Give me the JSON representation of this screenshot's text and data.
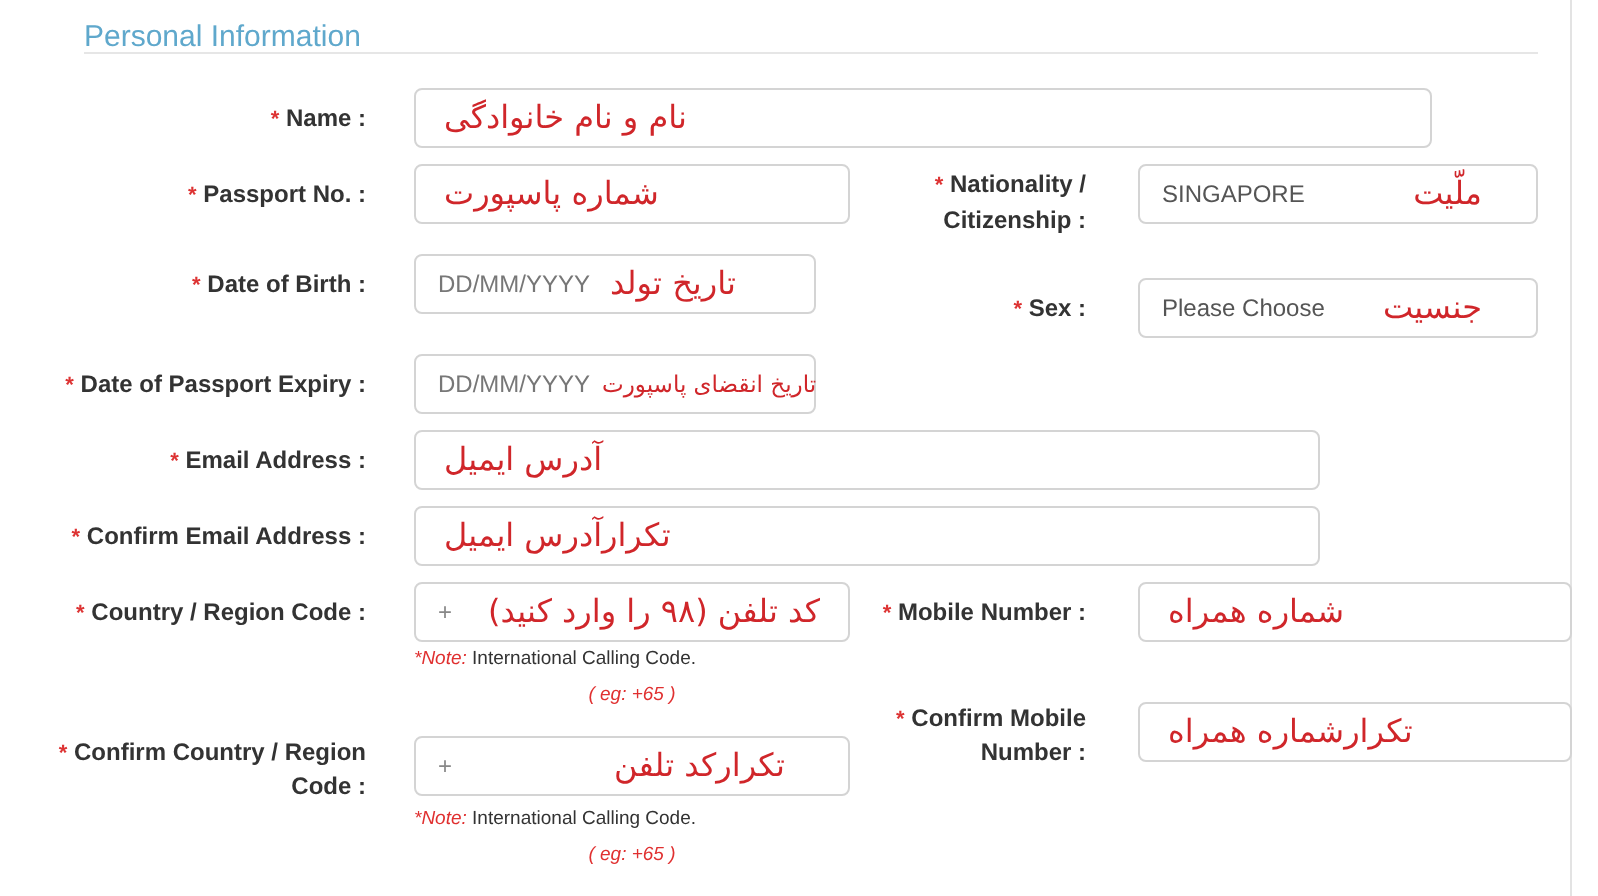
{
  "section": {
    "title": "Personal Information"
  },
  "rows": [
    {
      "field": {
        "marker": "*",
        "label": "Name :",
        "kind": "text",
        "annotation": "نام و نام خانوادگی"
      }
    },
    {
      "field": {
        "marker": "*",
        "label": "Passport No. :",
        "kind": "text",
        "annotation": "شماره پاسپورت"
      },
      "paired_field": {
        "marker": "*",
        "label": "Nationality / Citizenship :",
        "kind": "select",
        "value": "SINGAPORE",
        "annotation": "ملّیت"
      }
    },
    {
      "field": {
        "marker": "*",
        "label": "Date of Birth :",
        "kind": "date",
        "placeholder": "DD/MM/YYYY",
        "annotation": "تاریخ تولد"
      },
      "paired_field": {
        "marker": "*",
        "label": "Sex :",
        "kind": "select",
        "value": "Please Choose",
        "annotation": "جنسیت"
      }
    },
    {
      "field": {
        "marker": "*",
        "label": "Date of Passport Expiry :",
        "kind": "date",
        "placeholder": "DD/MM/YYYY",
        "annotation": "تاریخ انقضای پاسپورت"
      }
    },
    {
      "field": {
        "marker": "*",
        "label": "Email Address :",
        "kind": "text",
        "annotation": "آدرس ایمیل"
      }
    },
    {
      "field": {
        "marker": "*",
        "label": "Confirm Email Address :",
        "kind": "text",
        "annotation": "تکرارآدرس ایمیل"
      }
    },
    {
      "field": {
        "marker": "*",
        "label": "Country / Region Code :",
        "kind": "phone",
        "prefix": "+",
        "annotation": "کد تلفن (۹۸ را وارد کنید)"
      },
      "paired_field": {
        "marker": "*",
        "label": "Mobile Number :",
        "kind": "text",
        "annotation": "شماره همراه"
      },
      "note": {
        "label": "*Note:",
        "text": "International Calling Code.",
        "example": "( eg: +65 )"
      }
    },
    {
      "field": {
        "marker": "*",
        "label": "Confirm Country / Region Code :",
        "kind": "phone",
        "prefix": "+",
        "annotation": "تکرارکد تلفن"
      },
      "paired_field": {
        "marker": "*",
        "label": "Confirm Mobile Number :",
        "kind": "text",
        "annotation": "تکرارشماره همراه"
      },
      "note": {
        "label": "*Note:",
        "text": "International Calling Code.",
        "example": "( eg: +65 )"
      }
    }
  ]
}
